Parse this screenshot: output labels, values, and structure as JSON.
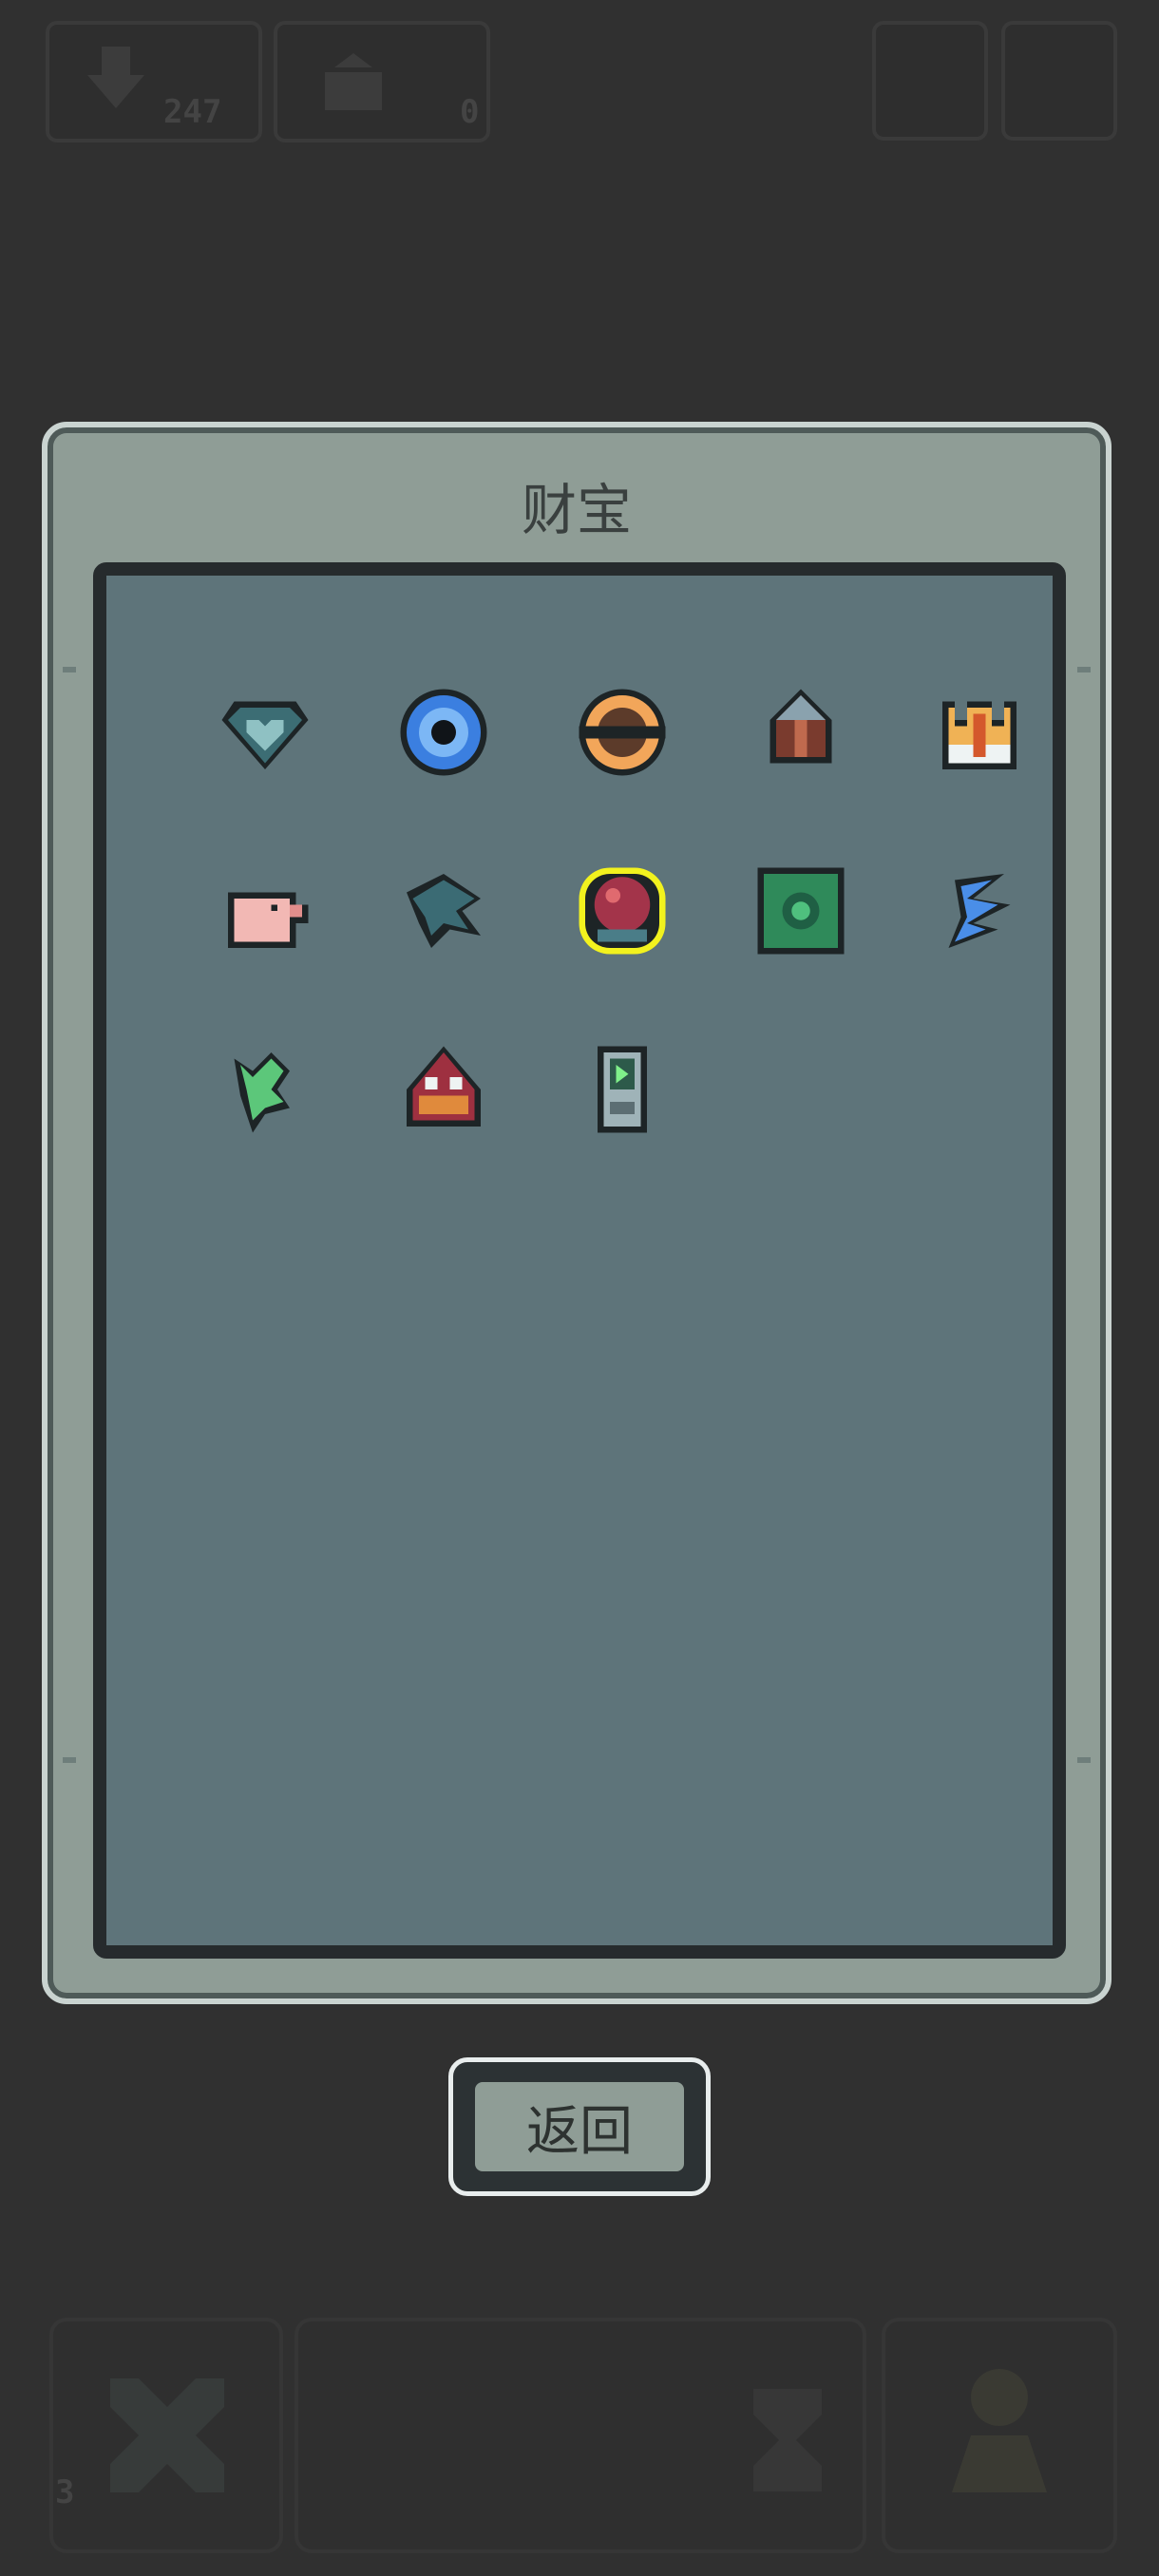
{
  "hud": {
    "top_left_counter": "247",
    "top_second_counter": "0",
    "bottom_left_counter": "3"
  },
  "panel": {
    "title": "财宝"
  },
  "treasures": [
    {
      "icon": "crystal-heart-icon"
    },
    {
      "icon": "blue-ring-icon"
    },
    {
      "icon": "orange-amulet-icon"
    },
    {
      "icon": "crest-helmet-icon"
    },
    {
      "icon": "golden-crown-icon"
    },
    {
      "icon": "pink-piggy-icon"
    },
    {
      "icon": "teal-fin-icon"
    },
    {
      "icon": "red-orb-icon",
      "selected": true
    },
    {
      "icon": "green-rune-tile-icon"
    },
    {
      "icon": "blue-feather-icon"
    },
    {
      "icon": "green-sprout-icon"
    },
    {
      "icon": "red-beetle-icon"
    },
    {
      "icon": "handheld-device-icon"
    }
  ],
  "buttons": {
    "back_label": "返回"
  },
  "colors": {
    "selected_outline": "#f2f21e",
    "panel_bg": "#8f9d96",
    "grid_bg": "#5e747a"
  }
}
